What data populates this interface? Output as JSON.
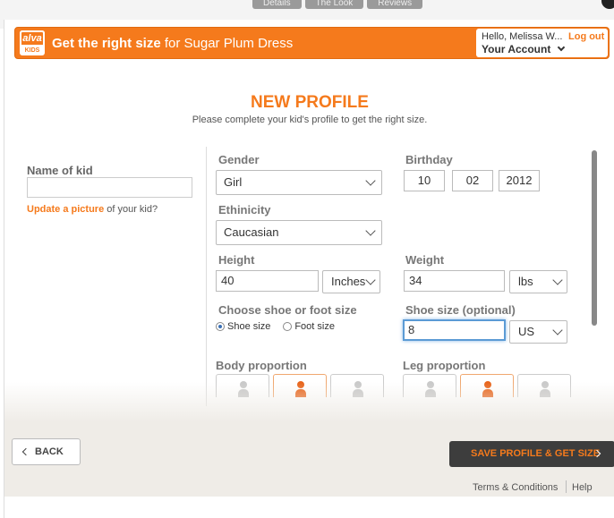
{
  "background_tabs": [
    "Details",
    "The Look",
    "Reviews"
  ],
  "logo": {
    "word": "alva",
    "sub": "KIDS"
  },
  "header": {
    "title_bold": "Get the right size",
    "title_rest": " for Sugar Plum Dress",
    "greeting": "Hello, Melissa W...",
    "logout": "Log out",
    "account": "Your Account"
  },
  "page": {
    "title": "NEW PROFILE",
    "subtitle": "Please complete your kid's profile to get the right size."
  },
  "kid": {
    "name_label": "Name of kid",
    "name_value": "",
    "update_link": "Update a picture",
    "update_rest": " of your kid?"
  },
  "form": {
    "gender_label": "Gender",
    "gender_value": "Girl",
    "birthday_label": "Birthday",
    "birthday_month": "10",
    "birthday_day": "02",
    "birthday_year": "2012",
    "ethnicity_label": "Ethinicity",
    "ethnicity_value": "Caucasian",
    "height_label": "Height",
    "height_value": "40",
    "height_unit": "Inches",
    "weight_label": "Weight",
    "weight_value": "34",
    "weight_unit": "lbs",
    "shoe_choice_label": "Choose shoe or foot size",
    "shoe_option": "Shoe size",
    "foot_option": "Foot size",
    "shoe_size_label": "Shoe size (optional)",
    "shoe_size_value": "8",
    "shoe_size_unit": "US",
    "body_label": "Body proportion",
    "leg_label": "Leg proportion"
  },
  "buttons": {
    "back": "BACK",
    "save": "SAVE PROFILE & GET SIZE"
  },
  "footer": {
    "terms": "Terms & Conditions",
    "help": "Help"
  },
  "colors": {
    "accent": "#f57a1c",
    "dark_button": "#3d3d3d"
  }
}
